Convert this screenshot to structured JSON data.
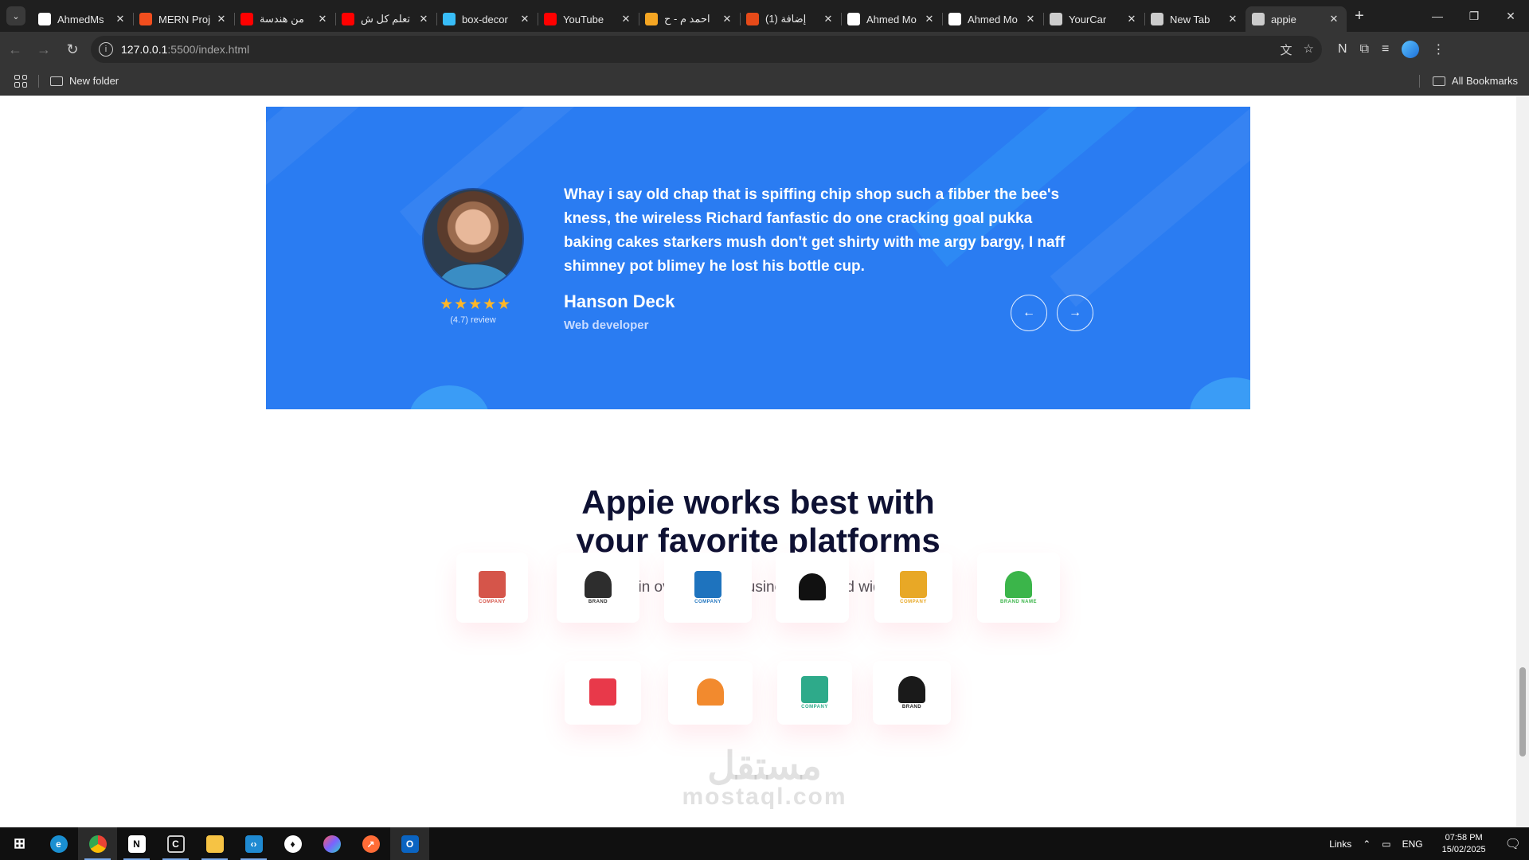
{
  "browser": {
    "tabs": [
      {
        "title": "AhmedMs",
        "icon": "github-icon",
        "color": "#ffffff"
      },
      {
        "title": "MERN Proj",
        "icon": "figma-icon",
        "color": "#f24e1e"
      },
      {
        "title": "من هندسة",
        "icon": "youtube-icon",
        "color": "#ff0000"
      },
      {
        "title": "تعلم كل ش",
        "icon": "youtube-icon",
        "color": "#ff0000"
      },
      {
        "title": "box-decor",
        "icon": "tailwind-icon",
        "color": "#38bdf8"
      },
      {
        "title": "YouTube",
        "icon": "youtube-icon",
        "color": "#ff0000"
      },
      {
        "title": "احمد م - ح",
        "icon": "five-icon",
        "color": "#f5a623"
      },
      {
        "title": "(1) إضافة",
        "icon": "chrome-colored-icon",
        "color": "#e64a19"
      },
      {
        "title": "Ahmed Mo",
        "icon": "vercel-icon",
        "color": "#ffffff"
      },
      {
        "title": "Ahmed Mo",
        "icon": "vercel-icon",
        "color": "#ffffff"
      },
      {
        "title": "YourCar",
        "icon": "car-icon",
        "color": "#cccccc"
      },
      {
        "title": "New Tab",
        "icon": "chrome-icon",
        "color": "#cccccc"
      },
      {
        "title": "appie",
        "icon": "globe-icon",
        "color": "#cccccc"
      }
    ],
    "url_host": "127.0.0.1",
    "url_path": ":5500/index.html",
    "bookmarks": {
      "folder": "New folder",
      "all": "All Bookmarks"
    }
  },
  "testimonial": {
    "quote": "Whay i say old chap that is spiffing chip shop such a fibber the bee's kness, the wireless Richard fanfastic do one cracking goal pukka baking cakes starkers mush don't get shirty with me argy bargy, I naff shimney pot blimey he lost his bottle cup.",
    "author": "Hanson Deck",
    "role": "Web developer",
    "stars": "★★★★★",
    "review": "(4.7) review",
    "prev_arrow": "←",
    "next_arrow": "→",
    "bg_color": "#2a7cf2"
  },
  "platforms": {
    "heading_line1": "Appie works best with",
    "heading_line2": "your favorite platforms",
    "subheading": "Join over 40,000 businesses world wide.",
    "brands_row1": [
      {
        "label": "COMPANY",
        "icon": "square-fold-logo-icon",
        "color": "#d5554a"
      },
      {
        "label": "BRAND",
        "icon": "leaf-wings-logo-icon",
        "color": "#2d2d2d"
      },
      {
        "label": "COMPANY",
        "icon": "blue-drop-logo-icon",
        "color": "#1e73be"
      },
      {
        "label": "",
        "icon": "js-logo-icon",
        "color": "#111111"
      },
      {
        "label": "COMPANY",
        "icon": "gold-ring-logo-icon",
        "color": "#e8a826"
      },
      {
        "label": "BRAND NAME",
        "icon": "green-star-logo-icon",
        "color": "#3bb54a"
      }
    ],
    "brands_row2": [
      {
        "label": "",
        "icon": "red-a-logo-icon",
        "color": "#e8394a"
      },
      {
        "label": "",
        "icon": "orange-n-logo-icon",
        "color": "#f28a2e"
      },
      {
        "label": "COMPANY",
        "icon": "teal-mountain-logo-icon",
        "color": "#2eaa8a"
      },
      {
        "label": "BRAND",
        "icon": "black-w-logo-icon",
        "color": "#1a1a1a"
      }
    ]
  },
  "watermark": {
    "arabic": "مستقل",
    "latin": "mostaql.com"
  },
  "taskbar": {
    "links_label": "Links",
    "language": "ENG",
    "time": "07:58 PM",
    "date": "15/02/2025"
  }
}
